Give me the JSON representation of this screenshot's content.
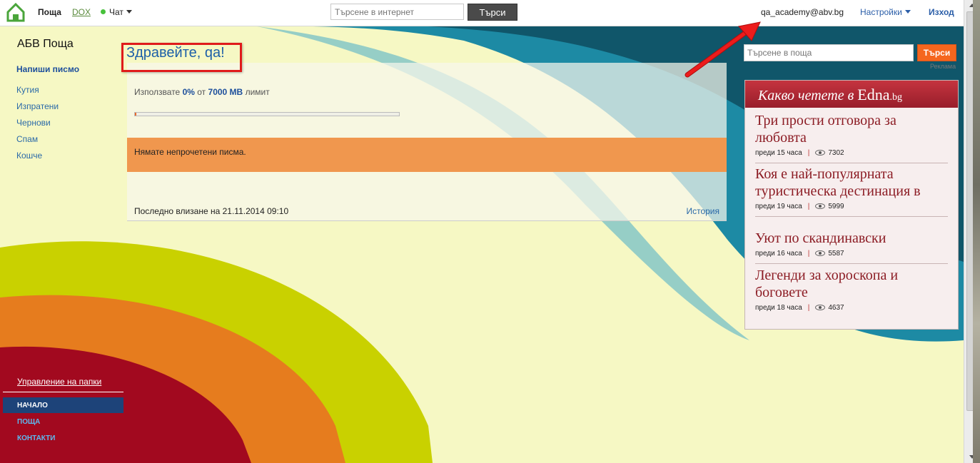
{
  "topbar": {
    "mail": "Поща",
    "dox": "DOX",
    "chat": "Чат",
    "search_placeholder": "Търсене в интернет",
    "search_button": "Търси",
    "user": "qa_academy@abv.bg",
    "settings": "Настройки",
    "logout": "Изход"
  },
  "sidebar": {
    "app_title": "АБВ Поща",
    "compose": "Напиши писмо",
    "folders": [
      {
        "label": "Кутия"
      },
      {
        "label": "Изпратени"
      },
      {
        "label": "Чернови"
      },
      {
        "label": "Спам"
      },
      {
        "label": "Кошче"
      }
    ],
    "manage_folders": "Управление на папки",
    "bottom_nav": [
      {
        "label": "НАЧАЛО",
        "active": true
      },
      {
        "label": "ПОЩА",
        "active": false
      },
      {
        "label": "КОНТАКТИ",
        "active": false
      }
    ]
  },
  "main": {
    "greeting": "Здравейте, qa!",
    "quota_prefix": "Използвате",
    "quota_used": "0%",
    "quota_mid": "от",
    "quota_total": "7000 MB",
    "quota_suffix": "лимит",
    "quota_fraction": 0,
    "unread_message": "Нямате непрочетени писма.",
    "last_login": "Последно влизане на 21.11.2014 09:10",
    "history_link": "История"
  },
  "right": {
    "mail_search_placeholder": "Търсене в поща",
    "mail_search_button": "Търси",
    "ad_label": "Реклама",
    "edna_heading": "Какво четете в",
    "edna_brand": "Edna",
    "edna_brand_suffix": ".bg",
    "articles": [
      {
        "title": "Три прости отговора за любовта",
        "time": "преди 15 часа",
        "views": "7302"
      },
      {
        "title": "Коя е най-популярната туристическа дестинация в",
        "time": "преди 19 часа",
        "views": "5999"
      },
      {
        "title": "Уют по скандинавски",
        "time": "преди 16 часа",
        "views": "5587"
      },
      {
        "title": "Легенди за хороскопа и боговете",
        "time": "преди 18 часа",
        "views": "4637"
      }
    ]
  },
  "colors": {
    "accent_blue": "#1d4f9c",
    "annotation_red": "#e01b1b",
    "orange": "#f0974e",
    "edna_red": "#981e2b"
  }
}
